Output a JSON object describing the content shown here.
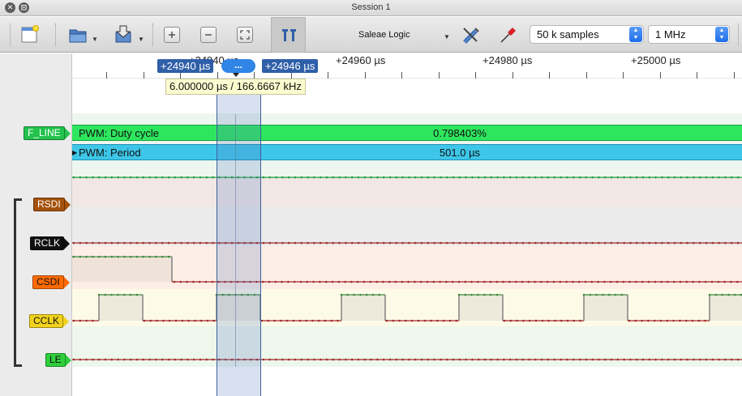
{
  "window": {
    "title": "Session 1"
  },
  "toolbar": {
    "device": "Saleae Logic",
    "sample_count": "50 k samples",
    "sample_rate": "1 MHz"
  },
  "ruler": {
    "ticks": [
      "+24940 µs",
      "+24960 µs",
      "+24980 µs",
      "+25000 µs"
    ]
  },
  "cursors": {
    "left_marker": "+24940 µs",
    "right_marker": "+24946 µs",
    "pill": "...",
    "measurement": "6.000000 µs / 166.6667 kHz"
  },
  "analyzers": [
    {
      "label": "PWM: Duty cycle",
      "value": "0.798403%",
      "color": "#2ee65e"
    },
    {
      "label": "PWM: Period",
      "value": "501.0 µs",
      "color": "#3ec6e8"
    }
  ],
  "channels": [
    {
      "name": "F_LINE",
      "color": "#22c24c",
      "text_color": "#ffffff",
      "signal": "low"
    },
    {
      "name": "RSDI",
      "color": "#a3520c",
      "text_color": "#ffffff",
      "signal": "none"
    },
    {
      "name": "RCLK",
      "color": "#111111",
      "text_color": "#ffffff",
      "signal": "low"
    },
    {
      "name": "CSDI",
      "color": "#ff6a00",
      "text_color": "#111111",
      "signal": "high-then-low"
    },
    {
      "name": "CCLK",
      "color": "#f2d21c",
      "text_color": "#111111",
      "signal": "clock"
    },
    {
      "name": "LE",
      "color": "#2fcf3c",
      "text_color": "#111111",
      "signal": "low"
    }
  ]
}
